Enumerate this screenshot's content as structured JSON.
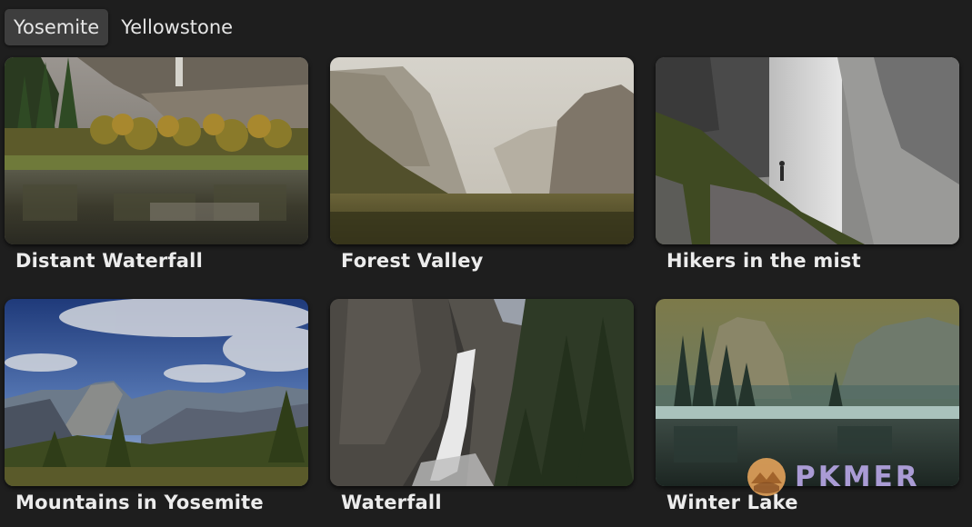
{
  "tabs": [
    {
      "label": "Yosemite",
      "active": true
    },
    {
      "label": "Yellowstone",
      "active": false
    }
  ],
  "gallery": [
    {
      "caption": "Distant Waterfall",
      "image": "meadow-reflection-image"
    },
    {
      "caption": "Forest Valley",
      "image": "misty-valley-image"
    },
    {
      "caption": "Hikers in the mist",
      "image": "waterfall-mist-trail-image"
    },
    {
      "caption": "Mountains in Yosemite",
      "image": "half-dome-panorama-image"
    },
    {
      "caption": "Waterfall",
      "image": "granite-waterfall-image"
    },
    {
      "caption": "Winter Lake",
      "image": "winter-lake-image"
    }
  ],
  "watermark": {
    "text": "PKMER",
    "icon": "pkmer-logo-icon"
  }
}
